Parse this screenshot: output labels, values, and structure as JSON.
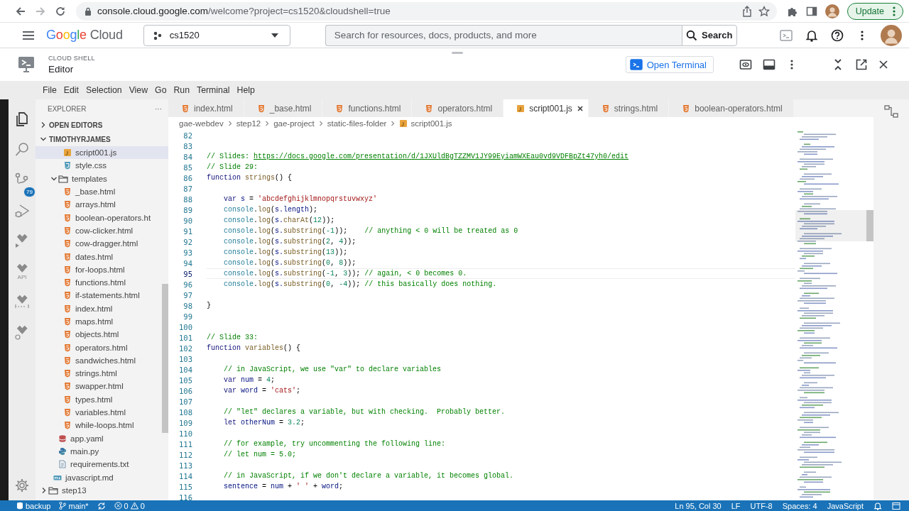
{
  "browser": {
    "host": "console.cloud.google.com",
    "path": "/welcome?project=cs1520&cloudshell=true",
    "update_label": "Update"
  },
  "console_header": {
    "logo": "Google",
    "logo_product": "Cloud",
    "project": "cs1520",
    "search": {
      "placeholder": "Search for resources, docs, products, and more"
    },
    "search_button": "Search"
  },
  "cloud_shell": {
    "label": "CLOUD SHELL",
    "title": "Editor",
    "open_terminal": "Open Terminal"
  },
  "menu": [
    "File",
    "Edit",
    "Selection",
    "View",
    "Go",
    "Run",
    "Terminal",
    "Help"
  ],
  "activity_bar": [
    {
      "kind": "explorer",
      "selected": true
    },
    {
      "kind": "search",
      "selected": false
    },
    {
      "kind": "source-control",
      "selected": false,
      "badge": "79"
    },
    {
      "kind": "run-debug",
      "selected": false
    },
    {
      "kind": "cloud-run",
      "selected": false
    },
    {
      "kind": "api",
      "selected": false,
      "label": "API"
    },
    {
      "kind": "cloud-code",
      "selected": false
    },
    {
      "kind": "cloud-settings",
      "selected": false
    }
  ],
  "explorer": {
    "title": "EXPLORER",
    "more": "···",
    "sections": [
      {
        "label": "OPEN EDITORS",
        "expanded": false
      },
      {
        "label": "TIMOTHYRJAMES",
        "expanded": true
      }
    ],
    "tree": [
      {
        "children": [
          {
            "children": [
              {
                "children": [
                  {
                    "label": "script001.js",
                    "kind": "js",
                    "selected": true
                  },
                  {
                    "label": "style.css",
                    "kind": "css",
                    "selected": false
                  }
                ]
              },
              {
                "label": "templates",
                "kind": "folder",
                "expanded": true,
                "selected": false,
                "children": [
                  {
                    "label": "_base.html",
                    "kind": "html",
                    "selected": false
                  },
                  {
                    "label": "arrays.html",
                    "kind": "html",
                    "selected": false
                  },
                  {
                    "label": "boolean-operators.ht",
                    "kind": "html",
                    "selected": false
                  },
                  {
                    "label": "cow-clicker.html",
                    "kind": "html",
                    "selected": false
                  },
                  {
                    "label": "cow-dragger.html",
                    "kind": "html",
                    "selected": false
                  },
                  {
                    "label": "dates.html",
                    "kind": "html",
                    "selected": false
                  },
                  {
                    "label": "for-loops.html",
                    "kind": "html",
                    "selected": false
                  },
                  {
                    "label": "functions.html",
                    "kind": "html",
                    "selected": false
                  },
                  {
                    "label": "if-statements.html",
                    "kind": "html",
                    "selected": false
                  },
                  {
                    "label": "index.html",
                    "kind": "html",
                    "selected": false
                  },
                  {
                    "label": "maps.html",
                    "kind": "html",
                    "selected": false
                  },
                  {
                    "label": "objects.html",
                    "kind": "html",
                    "selected": false
                  },
                  {
                    "label": "operators.html",
                    "kind": "html",
                    "selected": false
                  },
                  {
                    "label": "sandwiches.html",
                    "kind": "html",
                    "selected": false
                  },
                  {
                    "label": "strings.html",
                    "kind": "html",
                    "selected": false
                  },
                  {
                    "label": "swapper.html",
                    "kind": "html",
                    "selected": false
                  },
                  {
                    "label": "types.html",
                    "kind": "html",
                    "selected": false
                  },
                  {
                    "label": "variables.html",
                    "kind": "html",
                    "selected": false
                  },
                  {
                    "label": "while-loops.html",
                    "kind": "html",
                    "selected": false
                  }
                ]
              },
              {
                "label": "app.yaml",
                "kind": "yaml",
                "selected": false
              },
              {
                "label": "main.py",
                "kind": "python",
                "selected": false
              },
              {
                "label": "requirements.txt",
                "kind": "text",
                "selected": false
              }
            ]
          },
          {
            "label": "javascript.md",
            "kind": "markdown",
            "selected": false
          }
        ]
      },
      {
        "label": "step13",
        "kind": "folder",
        "expanded": false,
        "selected": false
      }
    ]
  },
  "tabs": [
    {
      "label": "index.html",
      "kind": "html",
      "selected": false
    },
    {
      "label": "_base.html",
      "kind": "html",
      "selected": false
    },
    {
      "label": "functions.html",
      "kind": "html",
      "selected": false
    },
    {
      "label": "operators.html",
      "kind": "html",
      "selected": false
    },
    {
      "label": "script001.js",
      "kind": "js",
      "selected": true
    },
    {
      "label": "strings.html",
      "kind": "html",
      "selected": false
    },
    {
      "label": "boolean-operators.html",
      "kind": "html",
      "selected": false
    }
  ],
  "breadcrumb": [
    {
      "label": "gae-webdev",
      "kind": "folder"
    },
    {
      "label": "step12",
      "kind": "folder"
    },
    {
      "label": "gae-project",
      "kind": "folder"
    },
    {
      "label": "static-files-folder",
      "kind": "folder"
    },
    {
      "label": "script001.js",
      "kind": "js"
    }
  ],
  "code": {
    "lines": [
      {
        "number": "82",
        "current": false
      },
      {
        "number": "83",
        "current": false
      },
      {
        "number": "84",
        "current": false,
        "segments": [
          {
            "kind": "comment",
            "text": "// Slides: "
          },
          {
            "kind": "link",
            "text": "https://docs.google.com/presentation/d/1JXUldBgTZZMV1JY99EyiamWXEau0vd9VDFBpZt47yh0/edit"
          }
        ]
      },
      {
        "number": "85",
        "current": false,
        "segments": [
          {
            "kind": "comment",
            "text": "// Slide 29:"
          }
        ]
      },
      {
        "number": "86",
        "current": false,
        "segments": [
          {
            "kind": "keyword",
            "text": "function "
          },
          {
            "kind": "function",
            "text": "strings"
          },
          {
            "kind": "plain",
            "text": "() {"
          }
        ]
      },
      {
        "number": "87",
        "current": false
      },
      {
        "number": "88",
        "current": false,
        "segments": [
          {
            "kind": "keyword",
            "text": "    var "
          },
          {
            "kind": "variable",
            "text": "s "
          },
          {
            "kind": "plain",
            "text": "= "
          },
          {
            "kind": "string",
            "text": "'abcdefghijklmnopqrstuvwxyz'"
          }
        ]
      },
      {
        "number": "89",
        "current": false,
        "segments": [
          {
            "kind": "object",
            "text": "    console"
          },
          {
            "kind": "plain",
            "text": "."
          },
          {
            "kind": "function",
            "text": "log"
          },
          {
            "kind": "plain",
            "text": "("
          },
          {
            "kind": "variable",
            "text": "s.length"
          },
          {
            "kind": "plain",
            "text": ");"
          }
        ]
      },
      {
        "number": "90",
        "current": false,
        "segments": [
          {
            "kind": "object",
            "text": "    console"
          },
          {
            "kind": "plain",
            "text": "."
          },
          {
            "kind": "function",
            "text": "log"
          },
          {
            "kind": "plain",
            "text": "("
          },
          {
            "kind": "variable",
            "text": "s."
          },
          {
            "kind": "function",
            "text": "charAt"
          },
          {
            "kind": "plain",
            "text": "("
          },
          {
            "kind": "number",
            "text": "12"
          },
          {
            "kind": "plain",
            "text": "));"
          }
        ]
      },
      {
        "number": "91",
        "current": false,
        "segments": [
          {
            "kind": "object",
            "text": "    console"
          },
          {
            "kind": "plain",
            "text": "."
          },
          {
            "kind": "function",
            "text": "log"
          },
          {
            "kind": "plain",
            "text": "("
          },
          {
            "kind": "variable",
            "text": "s."
          },
          {
            "kind": "function",
            "text": "substring"
          },
          {
            "kind": "plain",
            "text": "("
          },
          {
            "kind": "number",
            "text": "-1"
          },
          {
            "kind": "plain",
            "text": "));    "
          },
          {
            "kind": "comment",
            "text": "// anything < 0 will be treated as 0"
          }
        ]
      },
      {
        "number": "92",
        "current": false,
        "segments": [
          {
            "kind": "object",
            "text": "    console"
          },
          {
            "kind": "plain",
            "text": "."
          },
          {
            "kind": "function",
            "text": "log"
          },
          {
            "kind": "plain",
            "text": "("
          },
          {
            "kind": "variable",
            "text": "s."
          },
          {
            "kind": "function",
            "text": "substring"
          },
          {
            "kind": "plain",
            "text": "("
          },
          {
            "kind": "number",
            "text": "2"
          },
          {
            "kind": "plain",
            "text": ", "
          },
          {
            "kind": "number",
            "text": "4"
          },
          {
            "kind": "plain",
            "text": "));"
          }
        ]
      },
      {
        "number": "93",
        "current": false,
        "segments": [
          {
            "kind": "object",
            "text": "    console"
          },
          {
            "kind": "plain",
            "text": "."
          },
          {
            "kind": "function",
            "text": "log"
          },
          {
            "kind": "plain",
            "text": "("
          },
          {
            "kind": "variable",
            "text": "s."
          },
          {
            "kind": "function",
            "text": "substring"
          },
          {
            "kind": "plain",
            "text": "("
          },
          {
            "kind": "number",
            "text": "13"
          },
          {
            "kind": "plain",
            "text": "));"
          }
        ]
      },
      {
        "number": "94",
        "current": false,
        "segments": [
          {
            "kind": "object",
            "text": "    console"
          },
          {
            "kind": "plain",
            "text": "."
          },
          {
            "kind": "function",
            "text": "log"
          },
          {
            "kind": "plain",
            "text": "("
          },
          {
            "kind": "variable",
            "text": "s."
          },
          {
            "kind": "function",
            "text": "substring"
          },
          {
            "kind": "plain",
            "text": "("
          },
          {
            "kind": "number",
            "text": "0"
          },
          {
            "kind": "plain",
            "text": ", "
          },
          {
            "kind": "number",
            "text": "8"
          },
          {
            "kind": "plain",
            "text": "));"
          }
        ]
      },
      {
        "number": "95",
        "current": true,
        "segments": [
          {
            "kind": "object",
            "text": "    console"
          },
          {
            "kind": "plain",
            "text": "."
          },
          {
            "kind": "function",
            "text": "log"
          },
          {
            "kind": "plain",
            "text": "("
          },
          {
            "kind": "variable",
            "text": "s."
          },
          {
            "kind": "function",
            "text": "substring"
          },
          {
            "kind": "plain",
            "text": "("
          },
          {
            "kind": "number",
            "text": "-1"
          },
          {
            "kind": "plain",
            "text": ", "
          },
          {
            "kind": "number",
            "text": "3"
          },
          {
            "kind": "plain",
            "text": ")); "
          },
          {
            "kind": "comment",
            "text": "// again, < 0 becomes 0."
          }
        ]
      },
      {
        "number": "96",
        "current": false,
        "segments": [
          {
            "kind": "object",
            "text": "    console"
          },
          {
            "kind": "plain",
            "text": "."
          },
          {
            "kind": "function",
            "text": "log"
          },
          {
            "kind": "plain",
            "text": "("
          },
          {
            "kind": "variable",
            "text": "s."
          },
          {
            "kind": "function",
            "text": "substring"
          },
          {
            "kind": "plain",
            "text": "("
          },
          {
            "kind": "number",
            "text": "0"
          },
          {
            "kind": "plain",
            "text": ", "
          },
          {
            "kind": "number",
            "text": "-4"
          },
          {
            "kind": "plain",
            "text": ")); "
          },
          {
            "kind": "comment",
            "text": "// this basically does nothing."
          }
        ]
      },
      {
        "number": "97",
        "current": false
      },
      {
        "number": "98",
        "current": false,
        "segments": [
          {
            "kind": "plain",
            "text": "}"
          }
        ]
      },
      {
        "number": "99",
        "current": false
      },
      {
        "number": "100",
        "current": false
      },
      {
        "number": "101",
        "current": false,
        "segments": [
          {
            "kind": "comment",
            "text": "// Slide 33:"
          }
        ]
      },
      {
        "number": "102",
        "current": false,
        "segments": [
          {
            "kind": "keyword",
            "text": "function "
          },
          {
            "kind": "function",
            "text": "variables"
          },
          {
            "kind": "plain",
            "text": "() {"
          }
        ]
      },
      {
        "number": "103",
        "current": false
      },
      {
        "number": "104",
        "current": false,
        "segments": [
          {
            "kind": "comment",
            "text": "    // in JavaScript, we use \"var\" to declare variables"
          }
        ]
      },
      {
        "number": "105",
        "current": false,
        "segments": [
          {
            "kind": "keyword",
            "text": "    var "
          },
          {
            "kind": "variable",
            "text": "num "
          },
          {
            "kind": "plain",
            "text": "= "
          },
          {
            "kind": "number",
            "text": "4"
          },
          {
            "kind": "plain",
            "text": ";"
          }
        ]
      },
      {
        "number": "106",
        "current": false,
        "segments": [
          {
            "kind": "keyword",
            "text": "    var "
          },
          {
            "kind": "variable",
            "text": "word "
          },
          {
            "kind": "plain",
            "text": "= "
          },
          {
            "kind": "string",
            "text": "'cats'"
          },
          {
            "kind": "plain",
            "text": ";"
          }
        ]
      },
      {
        "number": "107",
        "current": false
      },
      {
        "number": "108",
        "current": false,
        "segments": [
          {
            "kind": "comment",
            "text": "    // \"let\" declares a variable, but with checking.  Probably better."
          }
        ]
      },
      {
        "number": "109",
        "current": false,
        "segments": [
          {
            "kind": "keyword",
            "text": "    let "
          },
          {
            "kind": "variable",
            "text": "otherNum "
          },
          {
            "kind": "plain",
            "text": "= "
          },
          {
            "kind": "number",
            "text": "3.2"
          },
          {
            "kind": "plain",
            "text": ";"
          }
        ]
      },
      {
        "number": "110",
        "current": false
      },
      {
        "number": "111",
        "current": false,
        "segments": [
          {
            "kind": "comment",
            "text": "    // for example, try uncommenting the following line:"
          }
        ]
      },
      {
        "number": "112",
        "current": false,
        "segments": [
          {
            "kind": "comment",
            "text": "    // let num = 5.0;"
          }
        ]
      },
      {
        "number": "113",
        "current": false
      },
      {
        "number": "114",
        "current": false,
        "segments": [
          {
            "kind": "comment",
            "text": "    // in JavaScript, if we don't declare a variable, it becomes global."
          }
        ]
      },
      {
        "number": "115",
        "current": false,
        "segments": [
          {
            "kind": "variable",
            "text": "    sentence "
          },
          {
            "kind": "plain",
            "text": "= "
          },
          {
            "kind": "variable",
            "text": "num "
          },
          {
            "kind": "plain",
            "text": "+ "
          },
          {
            "kind": "string",
            "text": "' '"
          },
          {
            "kind": "plain",
            "text": " + "
          },
          {
            "kind": "variable",
            "text": "word"
          },
          {
            "kind": "plain",
            "text": ";"
          }
        ]
      },
      {
        "number": "116",
        "current": false
      }
    ]
  },
  "status_bar": {
    "left": [
      {
        "kind": "remote",
        "label": "backup"
      },
      {
        "kind": "branch",
        "label": "main*"
      },
      {
        "kind": "sync"
      },
      {
        "kind": "problems",
        "errors": "0",
        "warnings": "0"
      }
    ],
    "right": [
      "Ln 95, Col 30",
      "LF",
      "UTF-8",
      "Spaces: 4",
      "JavaScript"
    ]
  }
}
